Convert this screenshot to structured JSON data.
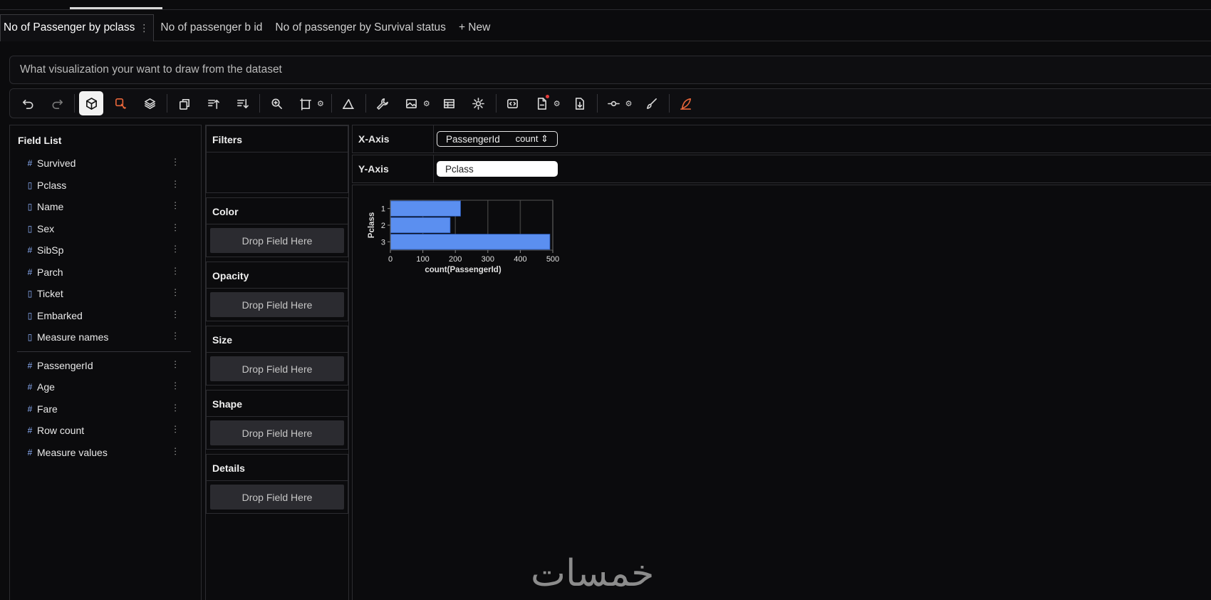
{
  "tabs": [
    {
      "label": "No of Passenger by pclass",
      "active": true
    },
    {
      "label": "No of passenger b id",
      "active": false
    },
    {
      "label": "No of passenger by Survival status",
      "active": false
    }
  ],
  "new_tab_label": "+ New",
  "prompt": {
    "placeholder": "What visualization your want to draw from the dataset"
  },
  "toolbar": {
    "icons": [
      "undo-icon",
      "redo-icon",
      "cube-icon",
      "lasso-icon",
      "layers-icon",
      "transpose-icon",
      "sort-ascending-icon",
      "sort-descending-icon",
      "zoom-icon",
      "resize-icon",
      "axes-icon",
      "wrench-icon",
      "image-icon",
      "table-icon",
      "settings-icon",
      "embed-icon",
      "export-file-icon",
      "download-icon",
      "brush-link-icon",
      "paintbrush-icon",
      "feather-icon"
    ],
    "active_icon": "cube-icon",
    "accent_orange": "#e8663a",
    "notification_dot_color": "#e23b3b"
  },
  "field_list": {
    "title": "Field List",
    "dimensions": [
      {
        "name": "Survived",
        "type": "quantitative"
      },
      {
        "name": "Pclass",
        "type": "nominal"
      },
      {
        "name": "Name",
        "type": "nominal"
      },
      {
        "name": "Sex",
        "type": "nominal"
      },
      {
        "name": "SibSp",
        "type": "quantitative"
      },
      {
        "name": "Parch",
        "type": "quantitative"
      },
      {
        "name": "Ticket",
        "type": "nominal"
      },
      {
        "name": "Embarked",
        "type": "nominal"
      },
      {
        "name": "Measure names",
        "type": "nominal"
      }
    ],
    "measures": [
      {
        "name": "PassengerId",
        "type": "quantitative"
      },
      {
        "name": "Age",
        "type": "quantitative"
      },
      {
        "name": "Fare",
        "type": "quantitative"
      },
      {
        "name": "Row count",
        "type": "quantitative"
      },
      {
        "name": "Measure values",
        "type": "quantitative"
      }
    ]
  },
  "encodings": {
    "filters_label": "Filters",
    "sections": [
      {
        "label": "Color",
        "drop": "Drop Field Here"
      },
      {
        "label": "Opacity",
        "drop": "Drop Field Here"
      },
      {
        "label": "Size",
        "drop": "Drop Field Here"
      },
      {
        "label": "Shape",
        "drop": "Drop Field Here"
      },
      {
        "label": "Details",
        "drop": "Drop Field Here"
      }
    ]
  },
  "axes": {
    "x_label": "X-Axis",
    "x_field": "PassengerId",
    "x_agg": "count",
    "y_label": "Y-Axis",
    "y_field": "Pclass"
  },
  "chart_data": {
    "type": "bar",
    "orientation": "horizontal",
    "categories": [
      "1",
      "2",
      "3"
    ],
    "values": [
      216,
      184,
      491
    ],
    "xlabel": "count(PassengerId)",
    "ylabel": "Pclass",
    "xlim": [
      0,
      500
    ],
    "xticks": [
      0,
      100,
      200,
      300,
      400,
      500
    ],
    "grid": true,
    "bar_color": "#5b8ff0"
  },
  "watermark": "خمسات"
}
